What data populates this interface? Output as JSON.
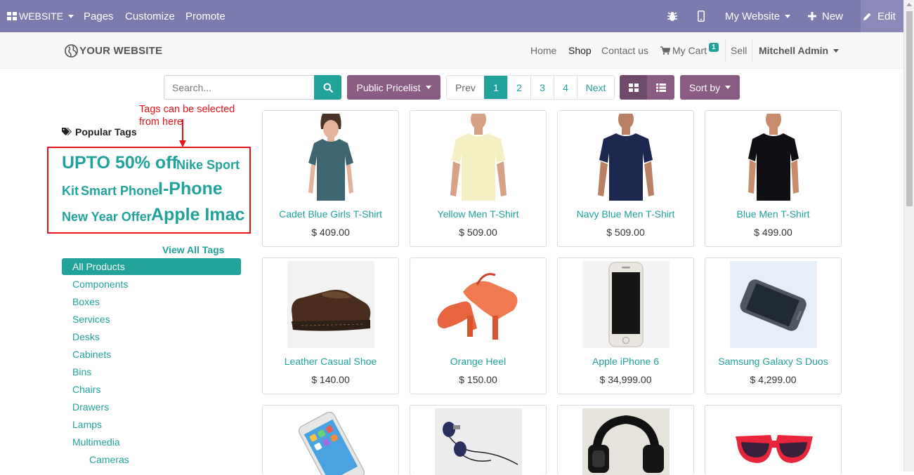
{
  "admin_bar": {
    "website_menu": "WEBSITE",
    "pages": "Pages",
    "customize": "Customize",
    "promote": "Promote",
    "my_website": "My Website",
    "new": "New",
    "edit": "Edit"
  },
  "header": {
    "logo": "YOUR WEBSITE",
    "nav": [
      "Home",
      "Shop",
      "Contact us"
    ],
    "cart_label": "My Cart",
    "cart_count": "1",
    "sell": "Sell",
    "user": "Mitchell Admin"
  },
  "toolbar": {
    "search_placeholder": "Search...",
    "pricelist": "Public Pricelist",
    "pager": [
      "Prev",
      "1",
      "2",
      "3",
      "4",
      "Next"
    ],
    "current_page": "1",
    "sort": "Sort by"
  },
  "annotation": {
    "text_line1": "Tags can be selected",
    "text_line2": "from here",
    "color": "#e5141b"
  },
  "sidebar": {
    "popular_tags_title": "Popular Tags",
    "tags": [
      "UPTO 50% off",
      "Nike Sport",
      "Kit",
      "Smart Phone",
      "I-Phone",
      "New Year Offer",
      "Apple Imac"
    ],
    "view_all": "View All Tags",
    "categories": [
      "All Products",
      "Components",
      "Boxes",
      "Services",
      "Desks",
      "Cabinets",
      "Bins",
      "Chairs",
      "Drawers",
      "Lamps",
      "Multimedia",
      "Cameras"
    ],
    "active_category": "All Products"
  },
  "products": [
    {
      "name": "Cadet Blue Girls T-Shirt",
      "price": "$ 409.00"
    },
    {
      "name": "Yellow Men T-Shirt",
      "price": "$ 509.00"
    },
    {
      "name": "Navy Blue Men T-Shirt",
      "price": "$ 509.00"
    },
    {
      "name": "Blue Men T-Shirt",
      "price": "$ 499.00"
    },
    {
      "name": "Leather Casual Shoe",
      "price": "$ 140.00"
    },
    {
      "name": "Orange Heel",
      "price": "$ 150.00"
    },
    {
      "name": "Apple iPhone 6",
      "price": "$ 34,999.00"
    },
    {
      "name": "Samsung Galaxy S Duos",
      "price": "$ 4,299.00"
    }
  ],
  "colors": {
    "admin_bar": "#7c7bad",
    "accent": "#21a29b",
    "purple_button": "#8a5b83"
  }
}
